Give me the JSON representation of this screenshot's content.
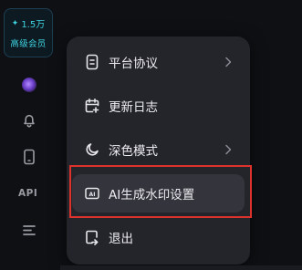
{
  "sidebar": {
    "vip": {
      "icon": "sparkle-icon",
      "count": "1.5万",
      "label": "高级会员"
    },
    "items": [
      {
        "icon": "avatar"
      },
      {
        "icon": "bell-icon"
      },
      {
        "icon": "phone-icon"
      },
      {
        "icon": "api-text",
        "label": "API"
      },
      {
        "icon": "menu-icon"
      }
    ]
  },
  "menu": {
    "items": [
      {
        "label": "平台协议",
        "icon": "document-icon",
        "has_submenu": true
      },
      {
        "label": "更新日志",
        "icon": "calendar-icon",
        "has_submenu": false
      },
      {
        "label": "深色模式",
        "icon": "moon-icon",
        "has_submenu": true
      },
      {
        "label": "AI生成水印设置",
        "icon": "ai-watermark-icon",
        "has_submenu": false,
        "active": true
      },
      {
        "label": "退出",
        "icon": "logout-icon",
        "has_submenu": false
      }
    ]
  },
  "colors": {
    "accent": "#3ed3e0",
    "highlight_border": "#e0322c",
    "menu_bg": "#24252b",
    "active_bg": "#34353c"
  }
}
